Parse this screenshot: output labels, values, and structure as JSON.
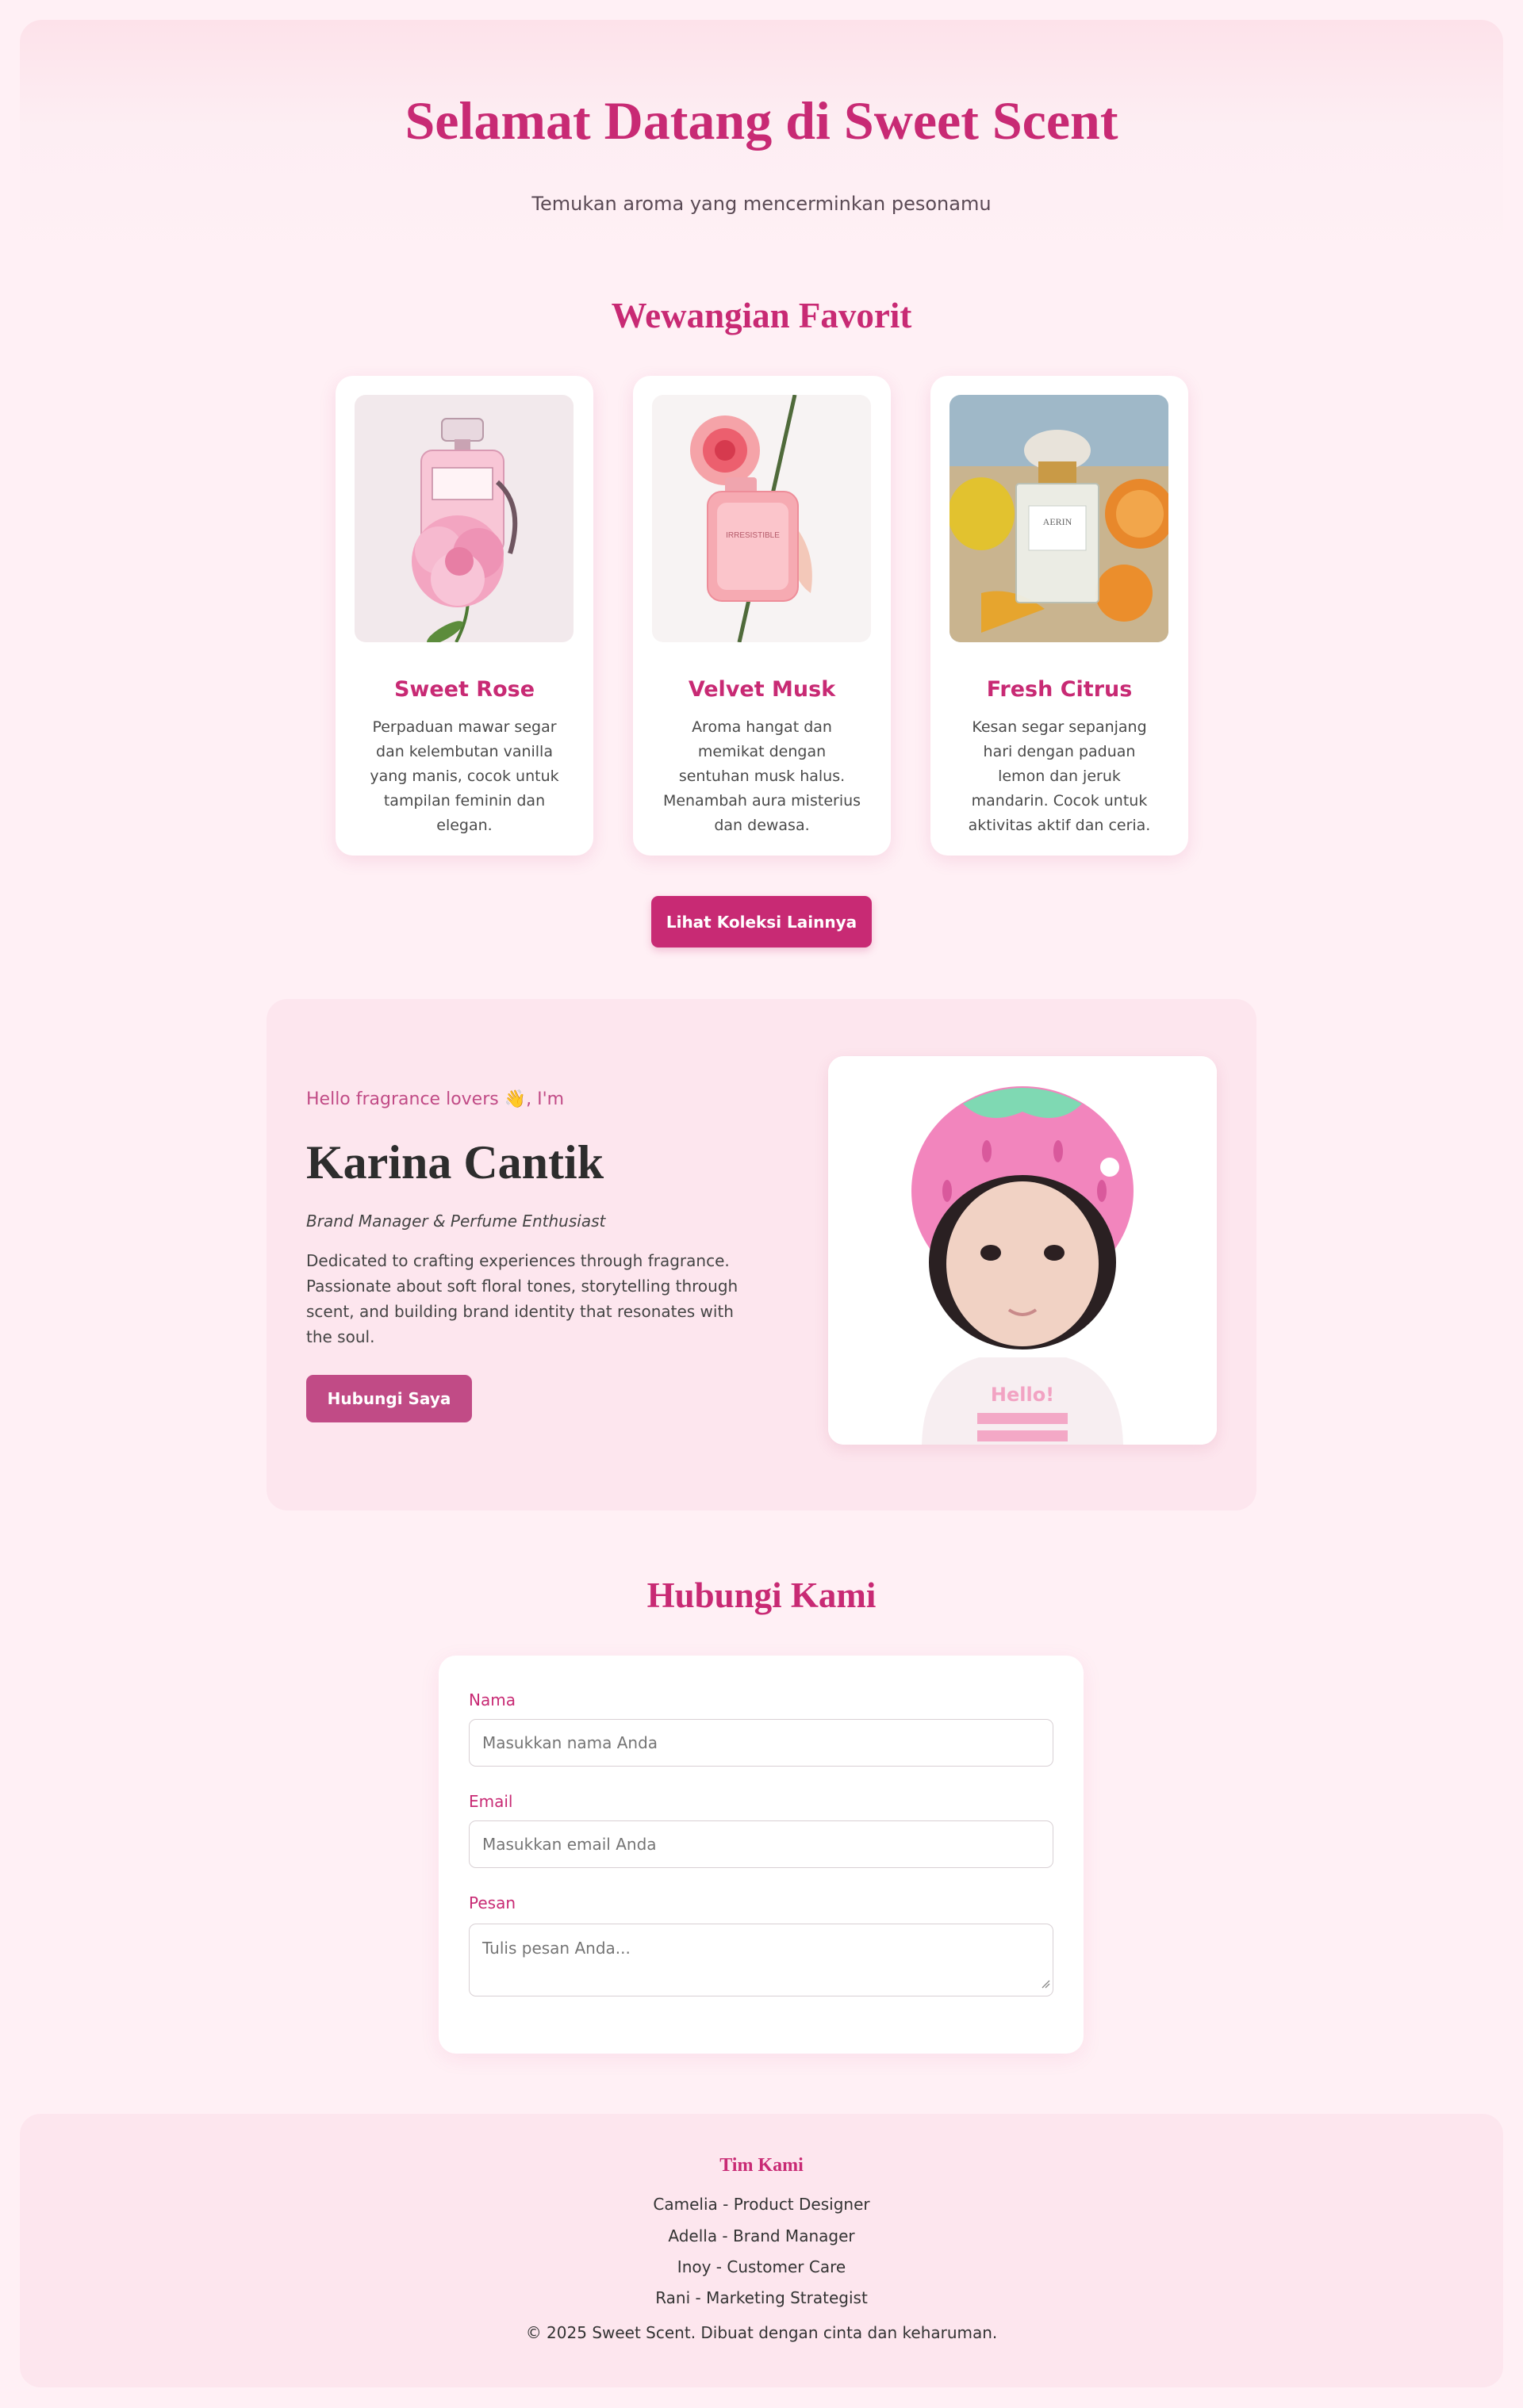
{
  "hero": {
    "title": "Selamat Datang di Sweet Scent",
    "subtitle": "Temukan aroma yang mencerminkan pesonamu"
  },
  "favorites": {
    "title": "Wewangian Favorit",
    "products": [
      {
        "name": "Sweet Rose",
        "description": "Perpaduan mawar segar dan kelembutan vanilla yang manis, cocok untuk tampilan feminin dan elegan."
      },
      {
        "name": "Velvet Musk",
        "description": "Aroma hangat dan memikat dengan sentuhan musk halus. Menambah aura misterius dan dewasa."
      },
      {
        "name": "Fresh Citrus",
        "description": "Kesan segar sepanjang hari dengan paduan lemon dan jeruk mandarin. Cocok untuk aktivitas aktif dan ceria."
      }
    ],
    "more_button": "Lihat Koleksi Lainnya",
    "bottle_labels": [
      "IRRESISTIBLE",
      "AERIN"
    ]
  },
  "profile": {
    "greeting": "Hello fragrance lovers 👋, I'm",
    "name": "Karina Cantik",
    "role": "Brand Manager & Perfume Enthusiast",
    "bio": "Dedicated to crafting experiences through fragrance. Passionate about soft floral tones, storytelling through scent, and building brand identity that resonates with the soul.",
    "contact_button": "Hubungi Saya",
    "shirt_text": "Hello!"
  },
  "contact": {
    "title": "Hubungi Kami",
    "name_label": "Nama",
    "name_placeholder": "Masukkan nama Anda",
    "email_label": "Email",
    "email_placeholder": "Masukkan email Anda",
    "message_label": "Pesan",
    "message_placeholder": "Tulis pesan Anda..."
  },
  "footer": {
    "team_title": "Tim Kami",
    "members": [
      "Camelia - Product Designer",
      "Adella - Brand Manager",
      "Inoy - Customer Care",
      "Rani - Marketing Strategist"
    ],
    "copyright": "© 2025 Sweet Scent. Dibuat dengan cinta dan keharuman."
  },
  "colors": {
    "primary": "#c82a74",
    "secondary": "#c14b86",
    "background": "#fff0f5",
    "panel": "#fde6ee"
  }
}
